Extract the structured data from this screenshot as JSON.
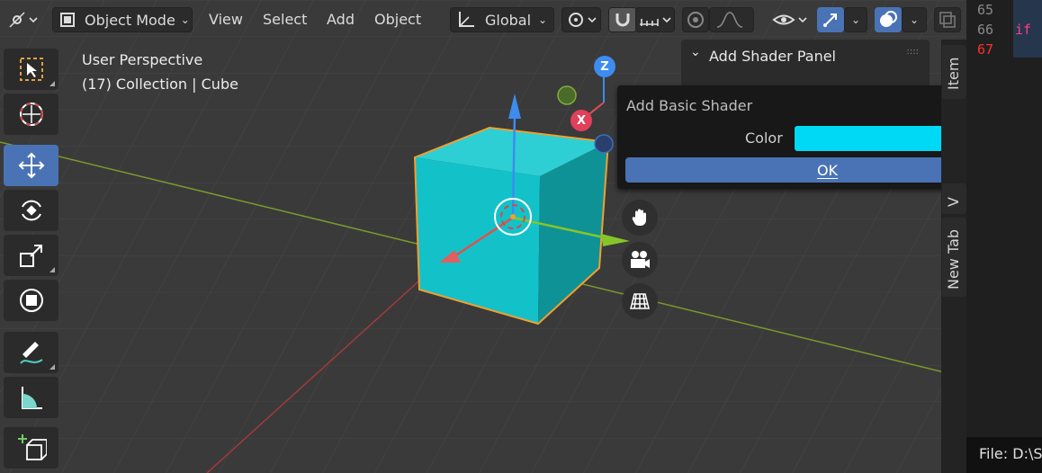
{
  "header": {
    "editor_type_icon": "view3d-icon",
    "mode_label": "Object Mode",
    "menus": [
      "View",
      "Select",
      "Add",
      "Object"
    ],
    "transform_orientation": "Global",
    "pivot_icon": "pivot-icon",
    "snap_icon": "magnet-icon",
    "snap_target_icon": "snap-increment-icon",
    "proportional_icon": "proportional-edit-icon",
    "falloff_icon": "falloff-curve-icon",
    "visibility_icon": "eye-icon",
    "gizmo_icon": "gizmo-arrow-icon",
    "overlay_icon": "overlay-icon",
    "xray_icon": "xray-icon"
  },
  "viewport": {
    "perspective_label": "User Perspective",
    "collection_label": "(17) Collection | Cube",
    "gizmo_axes": [
      "Z",
      "X"
    ],
    "object_color": "#13c2c9",
    "outline_color": "#f0a030"
  },
  "toolbar": {
    "tools": [
      "select-box-icon",
      "cursor-icon",
      "move-icon",
      "rotate-icon",
      "scale-icon",
      "transform-icon",
      "annotate-icon",
      "measure-icon",
      "add-cube-icon"
    ],
    "active_tool": "move-icon"
  },
  "nav": [
    "hand-pan-icon",
    "camera-icon",
    "grid-ortho-icon"
  ],
  "npanel": {
    "title": "Add Shader Panel",
    "tabs": [
      "Item",
      "V",
      "New Tab"
    ]
  },
  "popup": {
    "title": "Add Basic Shader",
    "color_label": "Color",
    "color_value": "#00d9f5",
    "ok_label": "OK"
  },
  "code_editor": {
    "line_numbers": [
      "65",
      "66",
      "67"
    ],
    "code_fragment": "if",
    "status": "File: D:\\S"
  }
}
